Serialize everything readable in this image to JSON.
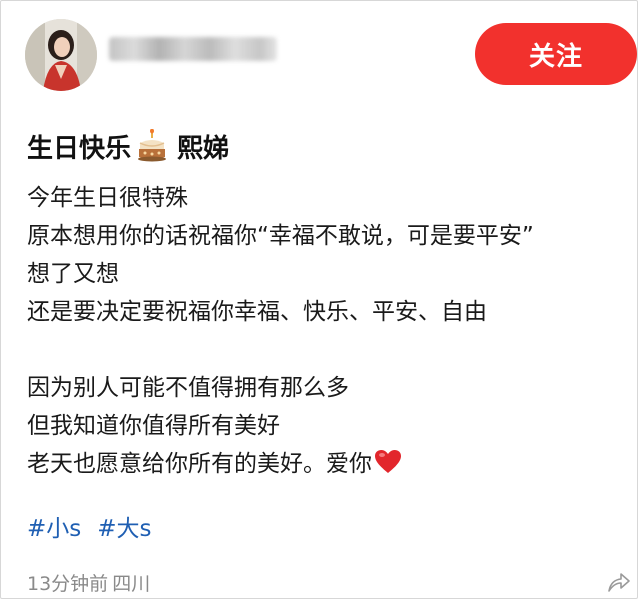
{
  "post": {
    "follow_label": "关注",
    "title": "生日快乐",
    "title_name": "熙娣",
    "lines": [
      "今年生日很特殊",
      "原本想用你的话祝福你“幸福不敢说，可是要平安”",
      "想了又想",
      "还是要决定要祝福你幸福、快乐、平安、自由",
      "",
      "因为别人可能不值得拥有那么多",
      "但我知道你值得所有美好",
      "老天也愿意给你所有的美好。爱你"
    ],
    "tags": [
      "#小s",
      "#大s"
    ],
    "time": "13分钟前",
    "location": "四川"
  },
  "colors": {
    "follow_button": "#f2312d",
    "tag_text": "#1f5fb3",
    "meta_text": "#8a8a8a"
  },
  "icons": {
    "cake": "cake-icon",
    "heart": "red-heart-icon",
    "share": "share-arrow-icon"
  }
}
